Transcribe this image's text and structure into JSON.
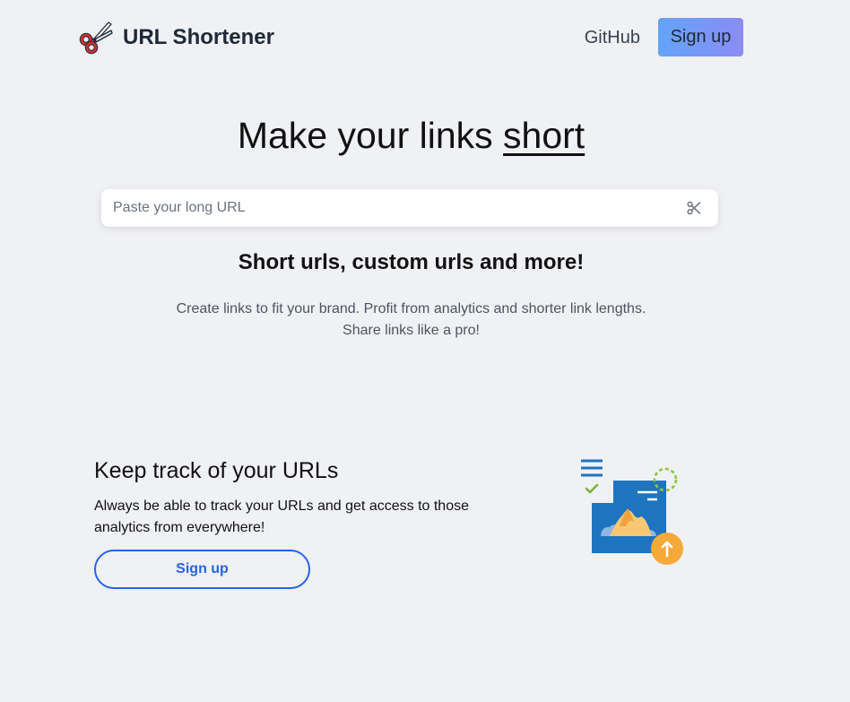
{
  "app": {
    "title": "URL Shortener",
    "logo_icon": "scissors-logo-icon"
  },
  "header": {
    "nav": {
      "github_label": "GitHub",
      "signup_label": "Sign up"
    }
  },
  "hero": {
    "title_prefix": "Make your links ",
    "title_emphasis": "short",
    "search": {
      "placeholder": "Paste your long URL",
      "value": "",
      "action_icon": "scissors-icon"
    },
    "subtitle": "Short urls, custom urls and more!",
    "description_lines": [
      "Create links to fit your brand. Profit from analytics and shorter link lengths.",
      "Share links like a pro!"
    ]
  },
  "feature": {
    "title": "Keep track of your URLs",
    "description": "Always be able to track your URLs and get access to those analytics from everywhere!",
    "cta_label": "Sign up",
    "illustration_icon": "analytics-report-illustration"
  },
  "colors": {
    "background": "#f0f1f4",
    "signup_gradient_start": "#63a4f8",
    "signup_gradient_end": "#8a8cf5",
    "outline_button": "#2563eb",
    "logo_handle": "#d32f2f",
    "illustration_blue": "#1f74bf",
    "illustration_orange": "#f5a93a",
    "illustration_green": "#8cc63f"
  }
}
